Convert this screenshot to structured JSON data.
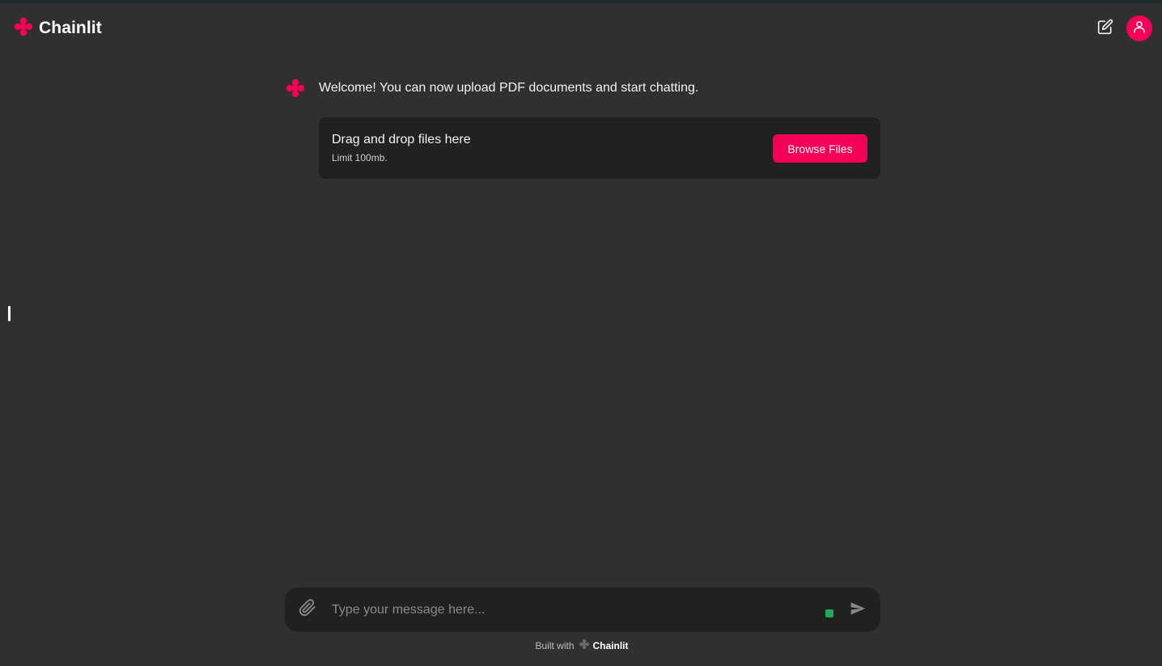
{
  "app": {
    "name": "Chainlit",
    "accent_color": "#f50057",
    "background_color": "#303030",
    "surface_color": "#212121"
  },
  "header": {
    "logo_text": "Chainlit",
    "logo_icon": "chainlit-logo-icon",
    "new_chat_icon": "edit-icon",
    "avatar_icon": "user-icon"
  },
  "chat": {
    "messages": [
      {
        "author_icon": "chainlit-logo-icon",
        "text": "Welcome! You can now upload PDF documents and start chatting."
      }
    ]
  },
  "upload": {
    "title": "Drag and drop files here",
    "limit": "Limit 100mb.",
    "button_label": "Browse Files"
  },
  "composer": {
    "placeholder": "Type your message here...",
    "value": "",
    "attach_icon": "paperclip-icon",
    "send_icon": "send-icon",
    "status_color": "#1fa855"
  },
  "footer": {
    "built_with": "Built with",
    "brand": "Chainlit"
  }
}
